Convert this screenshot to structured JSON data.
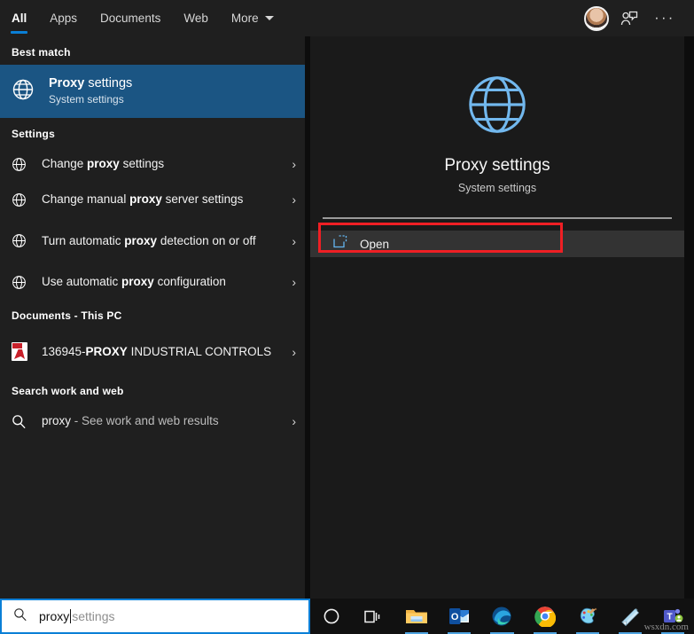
{
  "header": {
    "tabs": [
      {
        "label": "All",
        "active": true
      },
      {
        "label": "Apps",
        "active": false
      },
      {
        "label": "Documents",
        "active": false
      },
      {
        "label": "Web",
        "active": false
      },
      {
        "label": "More",
        "active": false,
        "caret": true
      }
    ],
    "avatar_name": "user-avatar",
    "feedback_icon": "person-chat-icon",
    "more_icon": "ellipsis-icon"
  },
  "results": {
    "best_match": {
      "heading": "Best match",
      "icon": "globe-icon",
      "title_bold": "Proxy",
      "title_rest": " settings",
      "subtitle": "System settings"
    },
    "settings": {
      "heading": "Settings",
      "items": [
        {
          "icon": "globe-icon",
          "pre": "Change ",
          "bold": "proxy",
          "post": " settings",
          "chevron": "›"
        },
        {
          "icon": "globe-icon",
          "pre": "Change manual ",
          "bold": "proxy",
          "post": " server settings",
          "chevron": "›"
        },
        {
          "icon": "globe-icon",
          "pre": "Turn automatic ",
          "bold": "proxy",
          "post": " detection on or off",
          "chevron": "›"
        },
        {
          "icon": "globe-icon",
          "pre": "Use automatic ",
          "bold": "proxy",
          "post": " configuration",
          "chevron": "›"
        }
      ]
    },
    "documents": {
      "heading": "Documents - This PC",
      "items": [
        {
          "icon": "pdf-file-icon",
          "pre": "136945-",
          "bold": "PROXY",
          "post": " INDUSTRIAL CONTROLS",
          "chevron": "›"
        }
      ]
    },
    "web": {
      "heading": "Search work and web",
      "items": [
        {
          "icon": "search-icon",
          "term": "proxy",
          "suffix": " - See work and web results",
          "chevron": "›"
        }
      ]
    }
  },
  "preview": {
    "icon": "globe-icon",
    "title": "Proxy settings",
    "subtitle": "System settings",
    "open_label": "Open",
    "open_icon": "open-external-icon",
    "highlight_color": "#ef1f24"
  },
  "searchbox": {
    "icon": "search-icon",
    "typed": "proxy",
    "suggestion": " settings"
  },
  "taskbar": {
    "items": [
      {
        "name": "cortana-icon",
        "running": false
      },
      {
        "name": "task-view-icon",
        "running": false
      },
      {
        "name": "file-explorer-icon",
        "running": true
      },
      {
        "name": "outlook-icon",
        "running": true
      },
      {
        "name": "edge-icon",
        "running": true
      },
      {
        "name": "chrome-icon",
        "running": true
      },
      {
        "name": "paint-icon",
        "running": true
      },
      {
        "name": "sticky-notes-icon",
        "running": true
      },
      {
        "name": "teams-icon",
        "running": true
      }
    ]
  },
  "watermark": "wsxdn.com"
}
